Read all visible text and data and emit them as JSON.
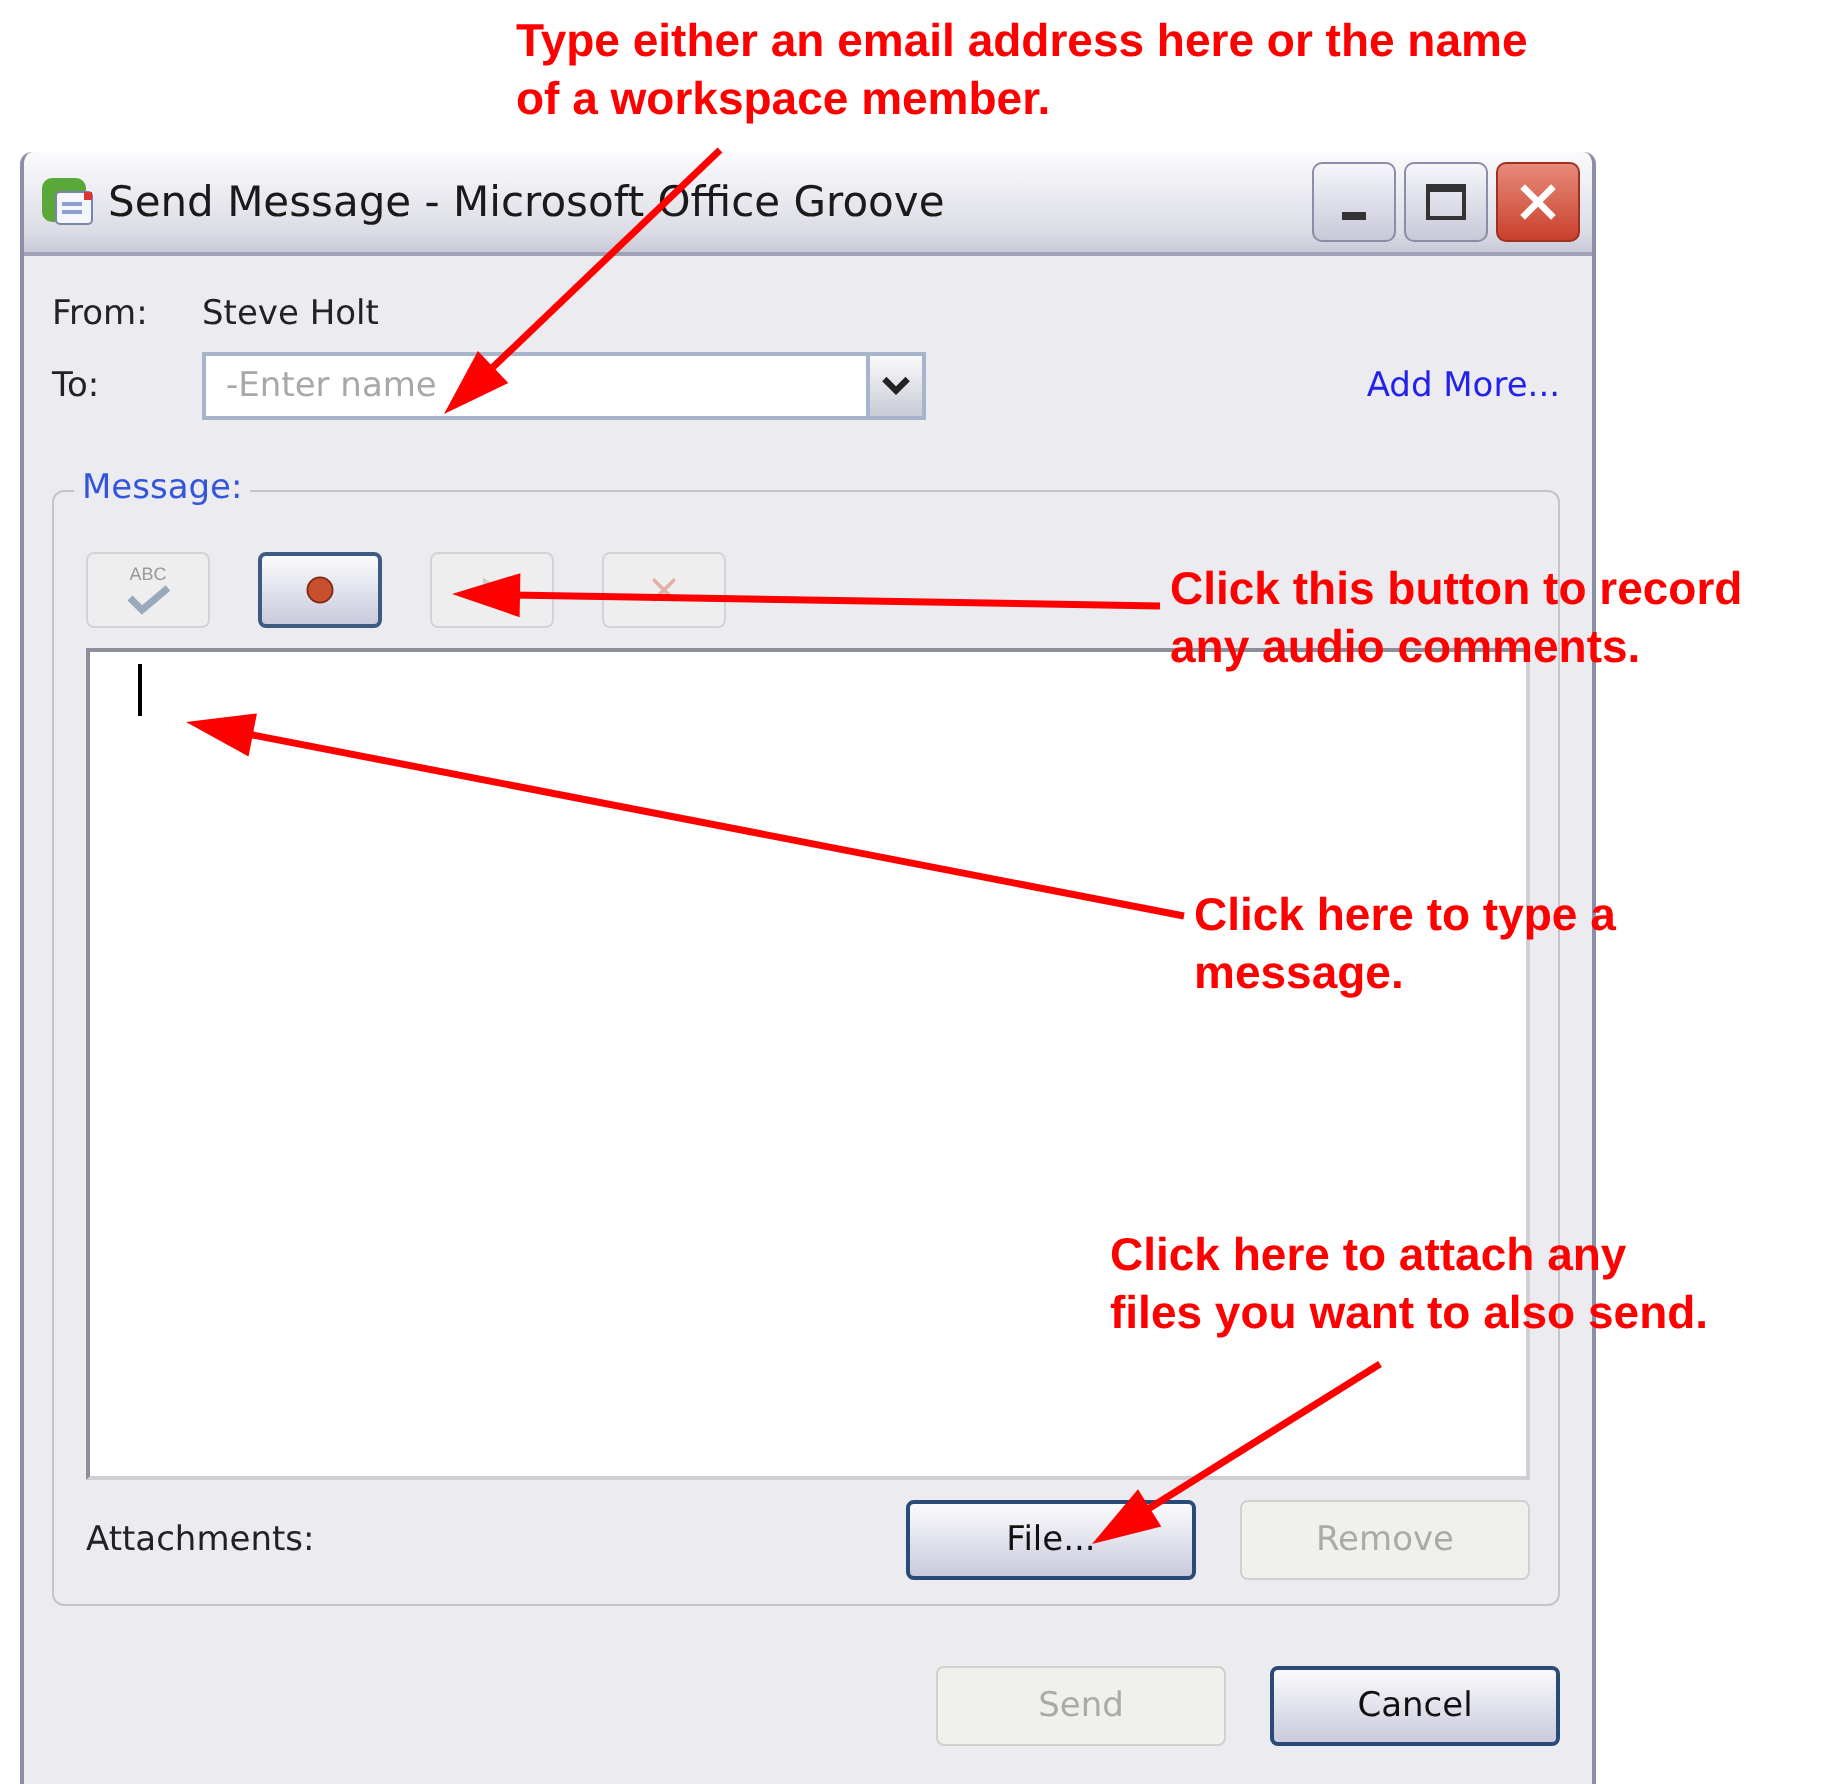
{
  "window": {
    "title": "Send Message - Microsoft Office Groove"
  },
  "from": {
    "label": "From:",
    "value": "Steve Holt"
  },
  "to": {
    "label": "To:",
    "placeholder": "-Enter name",
    "link": "Add More..."
  },
  "message": {
    "label": "Message:",
    "toolbar": [
      {
        "kind": "spellcheck",
        "disabled": true,
        "icon_text": "ABC"
      },
      {
        "kind": "record",
        "disabled": false
      },
      {
        "kind": "play",
        "disabled": true
      },
      {
        "kind": "delete",
        "disabled": true
      }
    ]
  },
  "attachments": {
    "label": "Attachments:",
    "buttons": [
      {
        "label": "File...",
        "disabled": false
      },
      {
        "label": "Remove",
        "disabled": true
      }
    ]
  },
  "footer_buttons": [
    {
      "label": "Send",
      "disabled": true
    },
    {
      "label": "Cancel",
      "disabled": false
    }
  ],
  "annotations": [
    {
      "lines": [
        "Type either an email address here or the name",
        "of a workspace member."
      ]
    },
    {
      "lines": [
        "Click this button to record",
        "any audio comments."
      ]
    },
    {
      "lines": [
        "Click here to type a",
        "message."
      ]
    },
    {
      "lines": [
        "Click here to attach any",
        "files you want to also send."
      ]
    }
  ]
}
